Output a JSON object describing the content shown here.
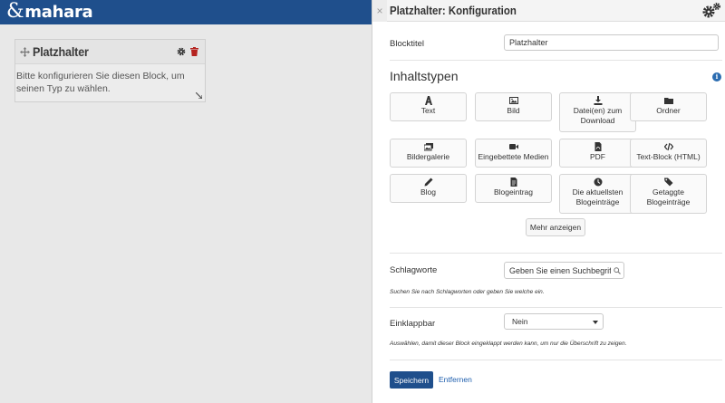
{
  "app": {
    "logo_text": "mahara"
  },
  "page_block": {
    "title": "Platzhalter",
    "body_text": "Bitte konfigurieren Sie diesen Block, um seinen Typ zu wählen."
  },
  "panel": {
    "close_label": "×",
    "title": "Platzhalter: Konfiguration",
    "block_title_label": "Blocktitel",
    "block_title_value": "Platzhalter",
    "content_types_heading": "Inhaltstypen",
    "info_icon_label": "i",
    "content_types": [
      {
        "label": "Text",
        "icon": "text-icon"
      },
      {
        "label": "Bild",
        "icon": "image-icon"
      },
      {
        "label": "Datei(en) zum Download",
        "icon": "download-icon"
      },
      {
        "label": "Ordner",
        "icon": "folder-icon"
      },
      {
        "label": "Bildergalerie",
        "icon": "gallery-icon"
      },
      {
        "label": "Eingebettete Medien",
        "icon": "video-icon"
      },
      {
        "label": "PDF",
        "icon": "pdf-icon"
      },
      {
        "label": "Text-Block (HTML)",
        "icon": "code-icon"
      },
      {
        "label": "Blog",
        "icon": "pencil-icon"
      },
      {
        "label": "Blogeintrag",
        "icon": "document-icon"
      },
      {
        "label": "Die aktuellsten Blogeinträge",
        "icon": "clock-icon"
      },
      {
        "label": "Getaggte Blogeinträge",
        "icon": "tags-icon"
      }
    ],
    "show_more_label": "Mehr anzeigen",
    "tags_label": "Schlagworte",
    "tags_placeholder": "Geben Sie einen Suchbegriff ein",
    "tags_hint": "Suchen Sie nach Schlagworten oder geben Sie welche ein.",
    "collapsible_label": "Einklappbar",
    "collapsible_value": "Nein",
    "collapsible_hint": "Auswählen, damit dieser Block eingeklappt werden kann, um nur die Überschrift zu zeigen.",
    "save_label": "Speichern",
    "remove_label": "Entfernen"
  },
  "colors": {
    "brand": "#1f4f8c",
    "link": "#1f5fae",
    "delete": "#b5231f"
  }
}
